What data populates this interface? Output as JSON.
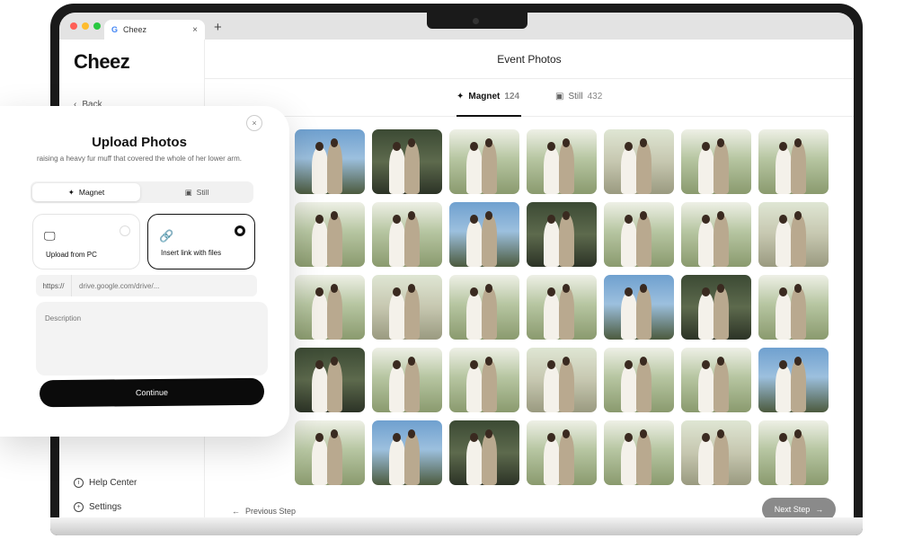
{
  "browser": {
    "tab_title": "Cheez",
    "tab_favicon": "G",
    "tab_close": "×",
    "new_tab": "+"
  },
  "sidebar": {
    "logo": "Cheez",
    "back_label": "Back",
    "help_center": "Help Center",
    "settings": "Settings"
  },
  "main": {
    "title": "Event Photos",
    "tabs": [
      {
        "label": "Magnet",
        "count": "124",
        "icon": "sparkles-icon",
        "active": true
      },
      {
        "label": "Still",
        "count": "432",
        "icon": "image-icon",
        "active": false
      }
    ],
    "previous_step": "Previous Step",
    "next_step": "Next Step",
    "photo_count_visible": 35
  },
  "upload_card": {
    "title": "Upload Photos",
    "subtitle": "raising a heavy fur muff that covered the whole of her lower arm.",
    "close": "×",
    "segments": [
      {
        "label": "Magnet",
        "active": true
      },
      {
        "label": "Still",
        "active": false
      }
    ],
    "options": [
      {
        "label": "Upload from PC",
        "icon": "monitor-icon",
        "selected": false
      },
      {
        "label": "Insert link with files",
        "icon": "link-icon",
        "selected": true
      }
    ],
    "url_prefix": "https://",
    "url_placeholder": "drive.google.com/drive/...",
    "description_placeholder": "Description",
    "continue_label": "Continue"
  },
  "colors": {
    "accent": "#111111",
    "next_button": "#8a8a8a"
  }
}
